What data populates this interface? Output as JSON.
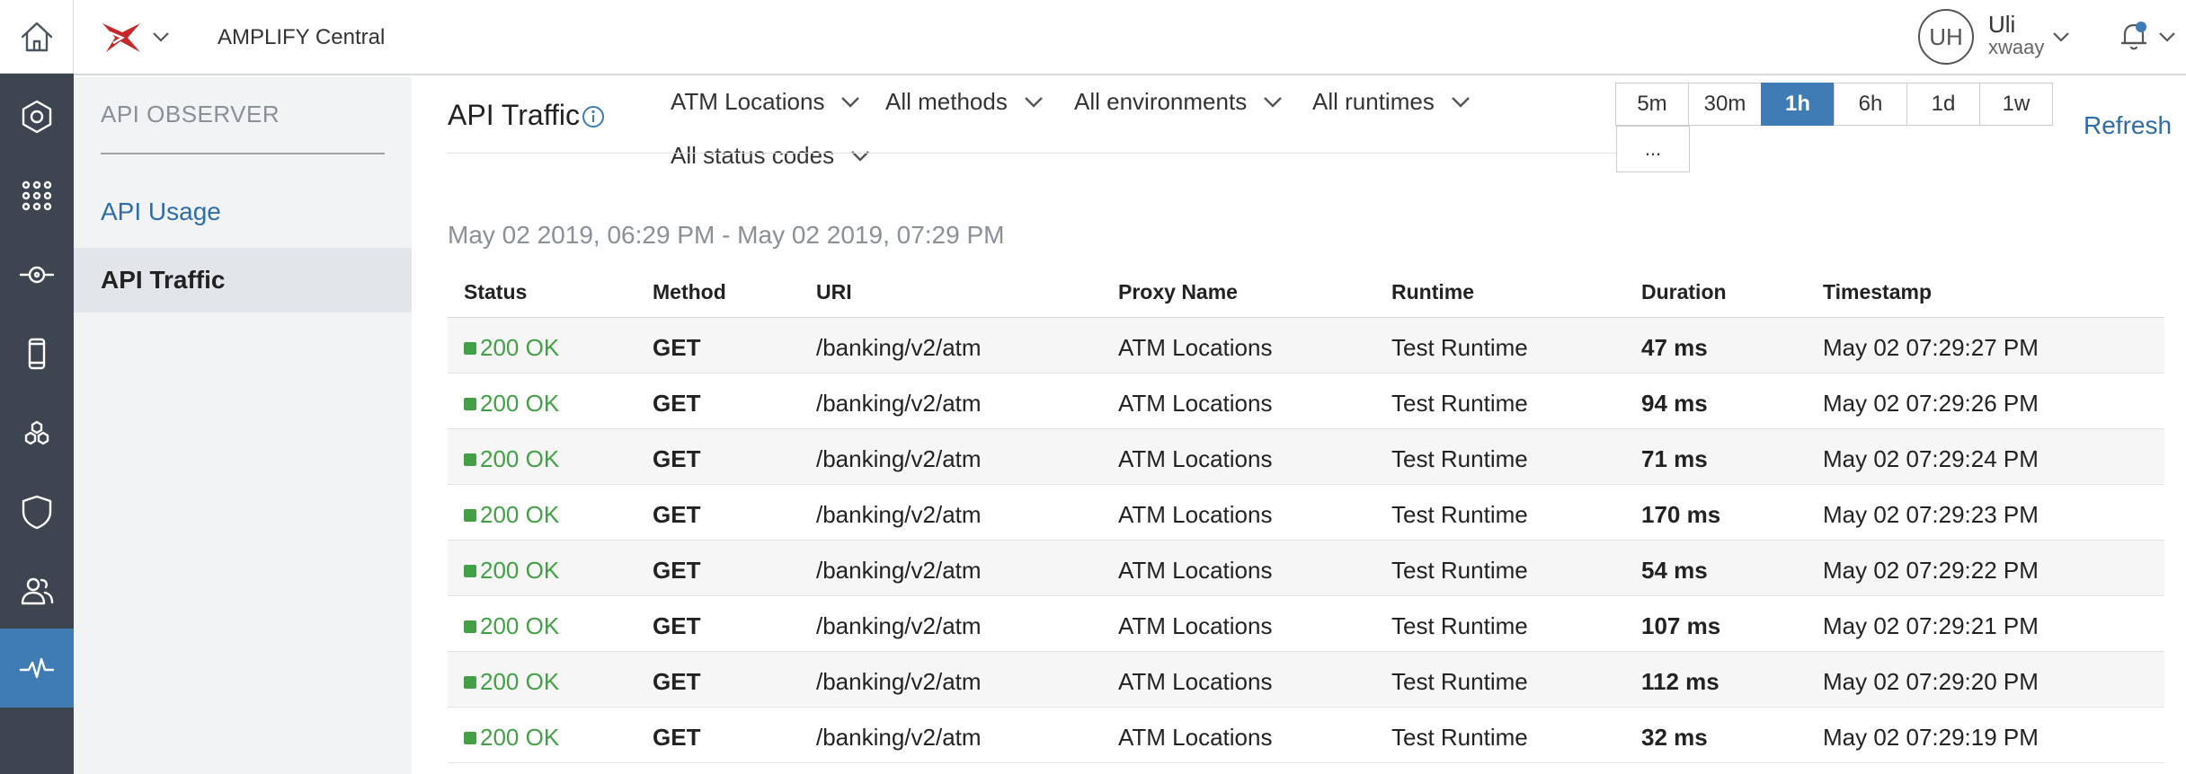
{
  "app": {
    "title": "AMPLIFY Central"
  },
  "user": {
    "initials": "UH",
    "name": "Uli",
    "org": "xwaay"
  },
  "colors": {
    "accent": "#3f7bb5",
    "rail": "#3c4550",
    "success": "#43a047",
    "logo_red": "#c62828"
  },
  "rail_icons": [
    "home-icon",
    "hexagon-icon",
    "apps-grid-icon",
    "target-icon",
    "mobile-icon",
    "hexagon-cluster-icon",
    "shield-icon",
    "users-icon",
    "pulse-icon"
  ],
  "subnav": {
    "title": "API OBSERVER",
    "items": [
      {
        "label": "API Usage"
      },
      {
        "label": "API Traffic"
      }
    ]
  },
  "main": {
    "title": "API Traffic",
    "filters": {
      "proxy": "ATM Locations",
      "methods": "All methods",
      "environments": "All environments",
      "runtimes": "All runtimes",
      "status_codes": "All status codes"
    },
    "time_ranges": [
      "5m",
      "30m",
      "1h",
      "6h",
      "1d",
      "1w"
    ],
    "time_selected": "1h",
    "time_more": "...",
    "refresh_label": "Refresh",
    "range_text": "May 02 2019, 06:29 PM - May 02 2019, 07:29 PM"
  },
  "table": {
    "headers": [
      "Status",
      "Method",
      "URI",
      "Proxy Name",
      "Runtime",
      "Duration",
      "Timestamp"
    ],
    "rows": [
      {
        "status": "200 OK",
        "method": "GET",
        "uri": "/banking/v2/atm",
        "proxy": "ATM Locations",
        "runtime": "Test Runtime",
        "duration": "47 ms",
        "timestamp": "May 02 07:29:27 PM"
      },
      {
        "status": "200 OK",
        "method": "GET",
        "uri": "/banking/v2/atm",
        "proxy": "ATM Locations",
        "runtime": "Test Runtime",
        "duration": "94 ms",
        "timestamp": "May 02 07:29:26 PM"
      },
      {
        "status": "200 OK",
        "method": "GET",
        "uri": "/banking/v2/atm",
        "proxy": "ATM Locations",
        "runtime": "Test Runtime",
        "duration": "71 ms",
        "timestamp": "May 02 07:29:24 PM"
      },
      {
        "status": "200 OK",
        "method": "GET",
        "uri": "/banking/v2/atm",
        "proxy": "ATM Locations",
        "runtime": "Test Runtime",
        "duration": "170 ms",
        "timestamp": "May 02 07:29:23 PM"
      },
      {
        "status": "200 OK",
        "method": "GET",
        "uri": "/banking/v2/atm",
        "proxy": "ATM Locations",
        "runtime": "Test Runtime",
        "duration": "54 ms",
        "timestamp": "May 02 07:29:22 PM"
      },
      {
        "status": "200 OK",
        "method": "GET",
        "uri": "/banking/v2/atm",
        "proxy": "ATM Locations",
        "runtime": "Test Runtime",
        "duration": "107 ms",
        "timestamp": "May 02 07:29:21 PM"
      },
      {
        "status": "200 OK",
        "method": "GET",
        "uri": "/banking/v2/atm",
        "proxy": "ATM Locations",
        "runtime": "Test Runtime",
        "duration": "112 ms",
        "timestamp": "May 02 07:29:20 PM"
      },
      {
        "status": "200 OK",
        "method": "GET",
        "uri": "/banking/v2/atm",
        "proxy": "ATM Locations",
        "runtime": "Test Runtime",
        "duration": "32 ms",
        "timestamp": "May 02 07:29:19 PM"
      }
    ]
  }
}
